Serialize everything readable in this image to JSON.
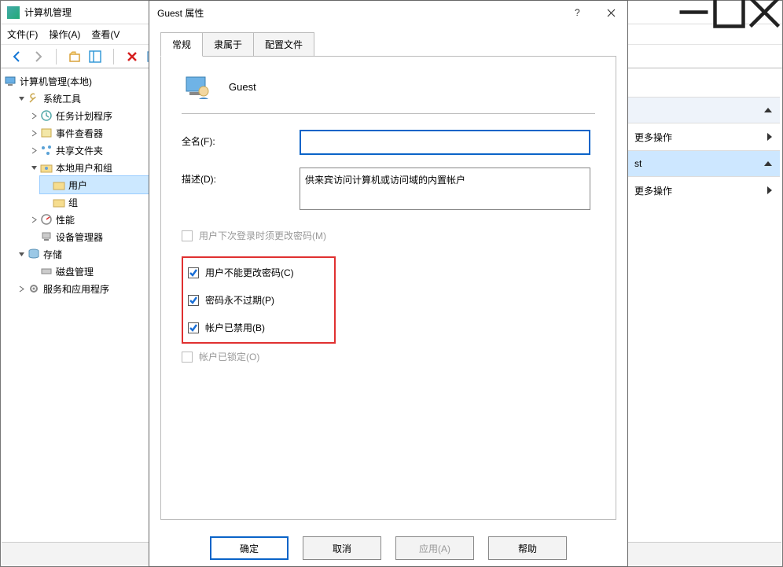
{
  "main": {
    "title": "计算机管理",
    "menus": [
      "文件(F)",
      "操作(A)",
      "查看(V"
    ]
  },
  "tree": {
    "root": "计算机管理(本地)",
    "sys_tools": "系统工具",
    "task_sched": "任务计划程序",
    "event_viewer": "事件查看器",
    "shared": "共享文件夹",
    "local_users": "本地用户和组",
    "users": "用户",
    "groups": "组",
    "perf": "性能",
    "devmgr": "设备管理器",
    "storage": "存储",
    "disk": "磁盘管理",
    "services": "服务和应用程序"
  },
  "actions": {
    "more1": "更多操作",
    "header2": "st",
    "more2": "更多操作"
  },
  "dialog": {
    "title": "Guest 属性",
    "tabs": {
      "general": "常规",
      "memberof": "隶属于",
      "profile": "配置文件"
    },
    "username": "Guest",
    "labels": {
      "fullname": "全名(F):",
      "description": "描述(D):"
    },
    "values": {
      "fullname": "",
      "description": "供来宾访问计算机或访问域的内置帐户"
    },
    "checks": {
      "must_change": "用户下次登录时须更改密码(M)",
      "cannot_change": "用户不能更改密码(C)",
      "never_expire": "密码永不过期(P)",
      "disabled": "帐户已禁用(B)",
      "locked": "帐户已锁定(O)"
    },
    "buttons": {
      "ok": "确定",
      "cancel": "取消",
      "apply": "应用(A)",
      "help": "帮助"
    }
  }
}
